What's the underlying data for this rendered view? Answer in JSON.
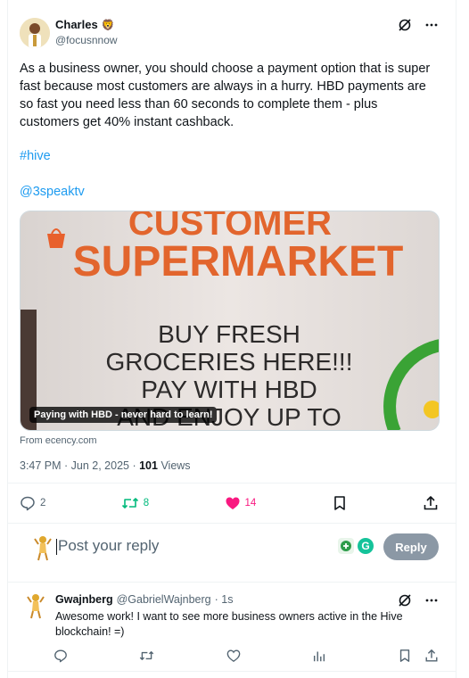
{
  "post": {
    "author_name": "Charles",
    "author_emoji": "🦁",
    "author_handle": "@focusnnow",
    "text": "As a business owner, you should choose a payment option that is super fast because most customers are always in a hurry. HBD payments are so fast you need less than 60 seconds to complete them - plus customers get 40% instant cashback.",
    "hashtag": "#hive",
    "mention": "@3speaktv",
    "media": {
      "sign_top": "CUSTOMER",
      "sign_main": "SUPERMARKET",
      "sign_lines": [
        "BUY FRESH",
        "GROCERIES HERE!!!",
        "PAY WITH HBD",
        "AND ENJOY UP TO"
      ],
      "caption": "Paying with HBD - never hard to learn!"
    },
    "source": "From ecency.com",
    "timestamp": "3:47 PM · Jun 2, 2025 · ",
    "views_count": "101",
    "views_label": " Views",
    "stats": {
      "replies": "2",
      "reposts": "8",
      "likes": "14"
    }
  },
  "reply_composer": {
    "placeholder": "Post your reply",
    "button_label": "Reply"
  },
  "comment": {
    "author_name": "Gwajnberg",
    "author_handle": "@GabrielWajnberg",
    "time": "· 1s",
    "text": "Awesome work! I want to see more business owners active in the Hive blockchain! =)"
  },
  "colors": {
    "link": "#1d9bf0",
    "repost_active": "#00ba7c",
    "like_active": "#f91880",
    "muted": "#536471",
    "reply_button_disabled": "#8b98a5"
  },
  "icons": [
    "grok-icon",
    "more-icon",
    "reply-icon",
    "repost-icon",
    "heart-icon",
    "bookmark-icon",
    "share-icon",
    "analytics-icon"
  ]
}
